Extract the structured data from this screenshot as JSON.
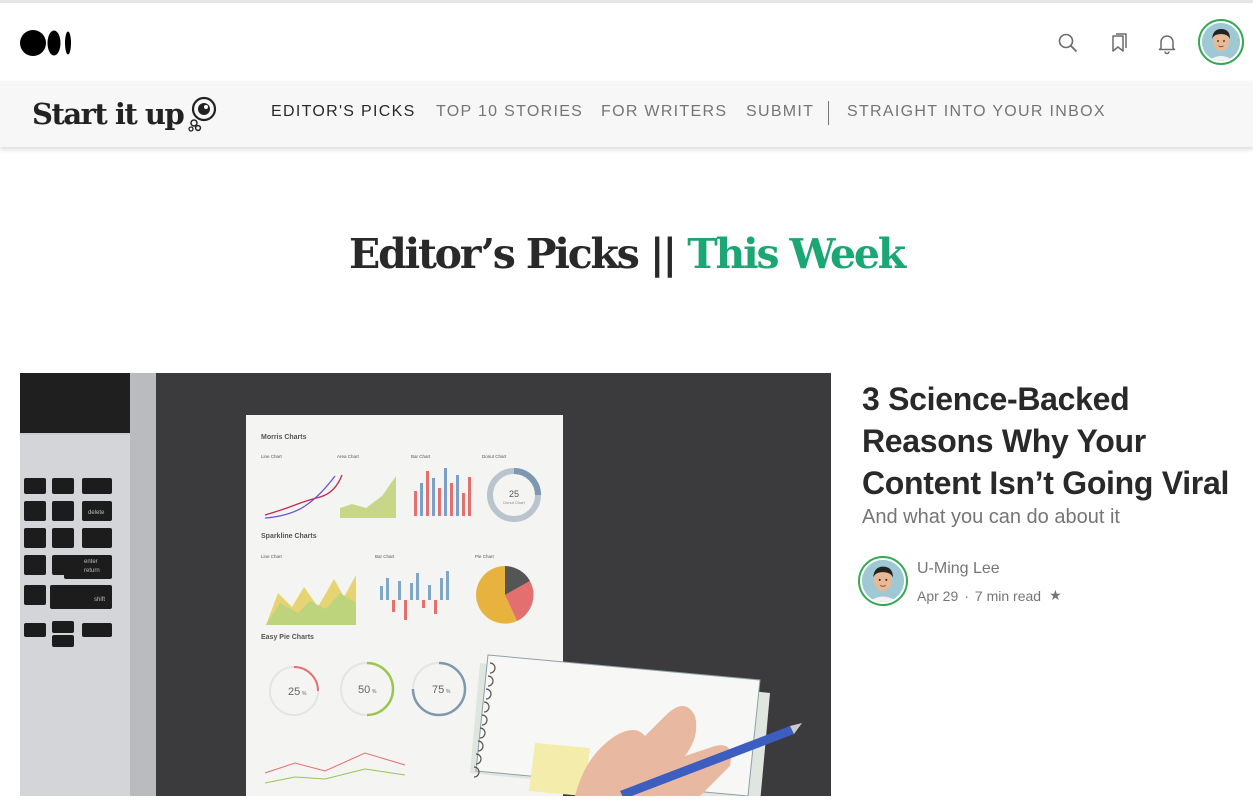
{
  "header": {
    "logo": "medium-logo",
    "icons": [
      "search-icon",
      "bookmarks-icon",
      "bell-icon"
    ],
    "avatar": "profile-avatar"
  },
  "publication": {
    "name": "Start it up",
    "nav": [
      {
        "label": "EDITOR'S PICKS",
        "active": true
      },
      {
        "label": "TOP 10 STORIES",
        "active": false
      },
      {
        "label": "FOR WRITERS",
        "active": false
      },
      {
        "label": "SUBMIT",
        "active": false
      },
      {
        "label": "STRAIGHT INTO YOUR INBOX",
        "active": false
      }
    ]
  },
  "section": {
    "title_main": "Editor’s Picks || ",
    "title_accent": "This Week",
    "accent_color": "#1aa774"
  },
  "article": {
    "title": "3 Science-Backed Reasons Why Your Content Isn’t Going Viral",
    "subtitle": "And what you can do about it",
    "author": "U-Ming Lee",
    "date": "Apr 29",
    "separator": "·",
    "read_time": "7 min read",
    "star": "★",
    "image": {
      "sheet_titles": [
        "Morris Charts",
        "Sparkline Charts",
        "Easy Pie Charts"
      ],
      "chart_labels": [
        "Line Chart",
        "Area Chart",
        "Bar Chart",
        "Donut Chart",
        "Line Chart",
        "Bar Chart",
        "Pie Chart"
      ],
      "donut_value": "25",
      "donut_caption": "Donut Chart",
      "pie_values": [
        "25",
        "50",
        "75"
      ],
      "percent_sign": "%",
      "keys": [
        "delete",
        "return",
        "shift",
        "enter"
      ]
    }
  }
}
